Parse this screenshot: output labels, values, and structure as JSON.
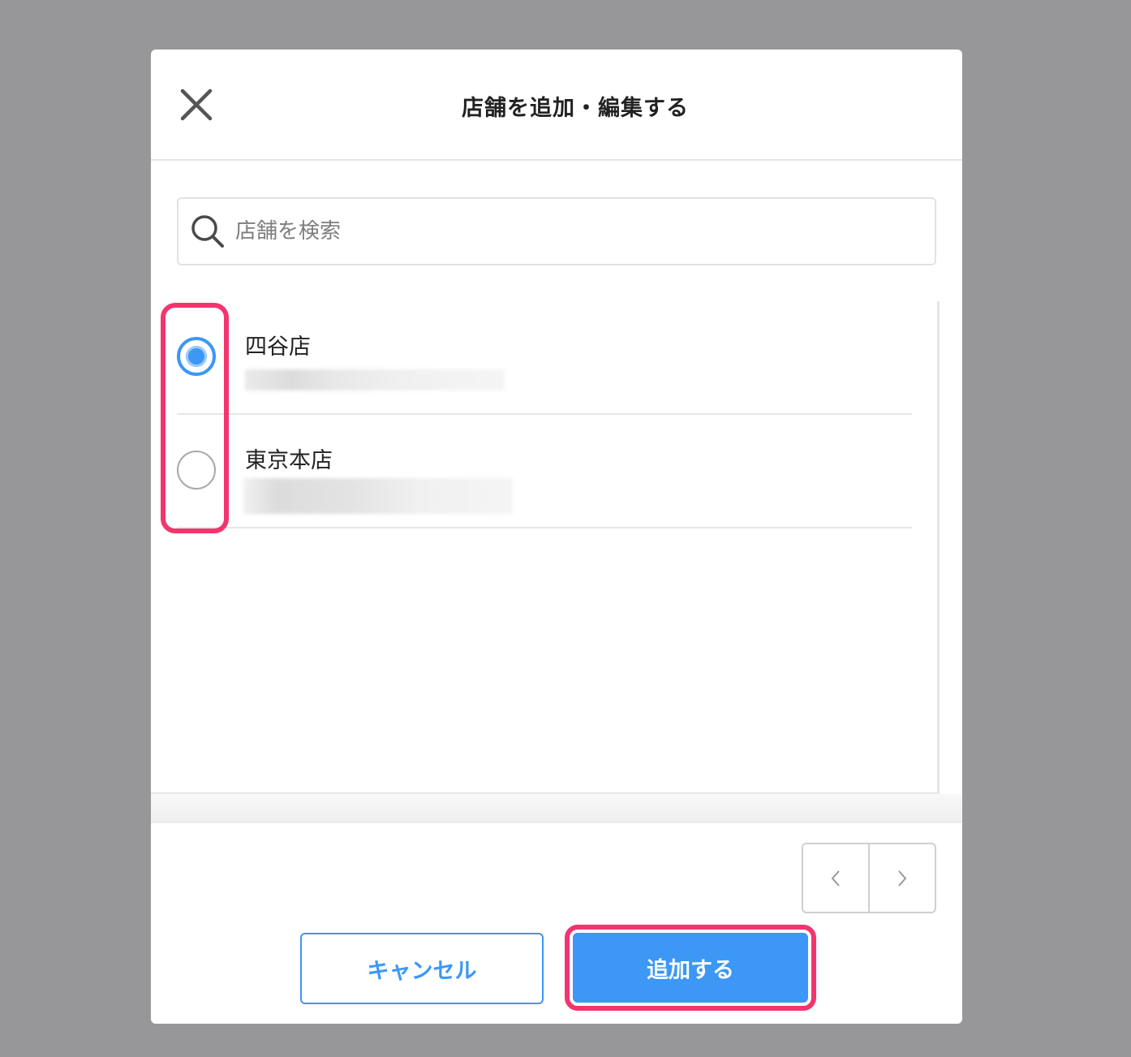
{
  "modal": {
    "title": "店舗を追加・編集する",
    "close_icon": "close-icon"
  },
  "search": {
    "placeholder": "店舗を検索",
    "value": "",
    "icon": "search-icon"
  },
  "stores": [
    {
      "name": "四谷店",
      "selected": true
    },
    {
      "name": "東京本店",
      "selected": false
    }
  ],
  "pagination": {
    "prev_icon": "chevron-left-icon",
    "next_icon": "chevron-right-icon"
  },
  "footer": {
    "cancel_label": "キャンセル",
    "add_label": "追加する"
  },
  "colors": {
    "accent": "#3c97f5",
    "highlight": "#f2356e",
    "backdrop": "#979799"
  }
}
